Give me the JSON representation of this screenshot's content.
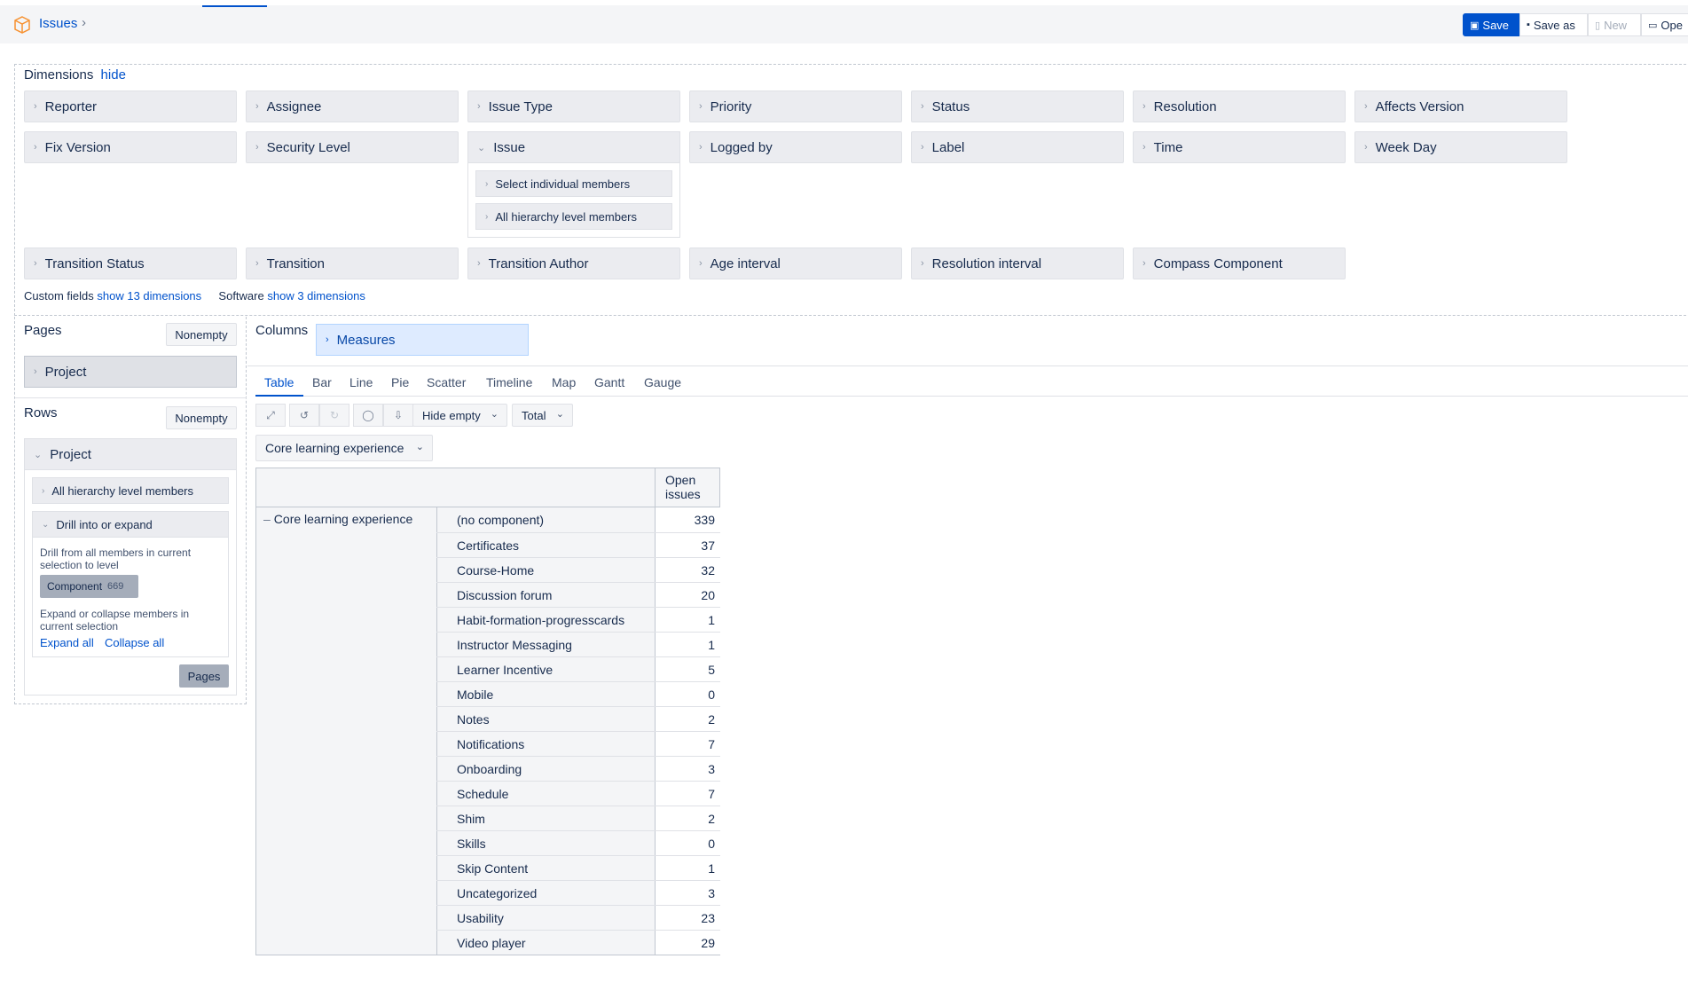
{
  "header": {
    "breadcrumb": "Issues",
    "buttons": {
      "save": "Save",
      "save_as": "Save as",
      "new": "New",
      "open": "Ope"
    }
  },
  "dimensions": {
    "title": "Dimensions",
    "hide_link": "hide",
    "row1": [
      "Reporter",
      "Assignee",
      "Issue Type",
      "Priority",
      "Status",
      "Resolution",
      "Affects Version"
    ],
    "row2": [
      "Fix Version",
      "Security Level",
      "Issue",
      "Logged by",
      "Label",
      "Time",
      "Week Day"
    ],
    "issue_sub": [
      "Select individual members",
      "All hierarchy level members"
    ],
    "row3": [
      "Transition Status",
      "Transition",
      "Transition Author",
      "Age interval",
      "Resolution interval",
      "Compass Component"
    ],
    "custom_fields_label": "Custom fields",
    "custom_fields_link": "show 13 dimensions",
    "software_label": "Software",
    "software_link": "show 3 dimensions"
  },
  "pages": {
    "label": "Pages",
    "nonempty": "Nonempty",
    "project": "Project"
  },
  "rows": {
    "label": "Rows",
    "nonempty": "Nonempty",
    "project": "Project",
    "all_hierarchy": "All hierarchy level members",
    "drill_title": "Drill into or expand",
    "drill_desc": "Drill from all members in current selection to level",
    "component_chip": "Component",
    "component_count": "669",
    "expand_desc": "Expand or collapse members in current selection",
    "expand_all": "Expand all",
    "collapse_all": "Collapse all",
    "pages_button": "Pages"
  },
  "columns": {
    "label": "Columns",
    "measures": "Measures"
  },
  "view_tabs": [
    "Table",
    "Bar",
    "Line",
    "Pie",
    "Scatter",
    "Timeline",
    "Map",
    "Gantt",
    "Gauge"
  ],
  "active_tab": "Table",
  "toolbar": {
    "hide_empty": "Hide empty",
    "total": "Total"
  },
  "page_filter": "Core learning experience",
  "table": {
    "column_header": "Open issues",
    "group_label": "Core learning experience",
    "rows": [
      {
        "name": "(no component)",
        "value": "339"
      },
      {
        "name": "Certificates",
        "value": "37"
      },
      {
        "name": "Course-Home",
        "value": "32"
      },
      {
        "name": "Discussion forum",
        "value": "20"
      },
      {
        "name": "Habit-formation-progresscards",
        "value": "1"
      },
      {
        "name": "Instructor Messaging",
        "value": "1"
      },
      {
        "name": "Learner Incentive",
        "value": "5"
      },
      {
        "name": "Mobile",
        "value": "0"
      },
      {
        "name": "Notes",
        "value": "2"
      },
      {
        "name": "Notifications",
        "value": "7"
      },
      {
        "name": "Onboarding",
        "value": "3"
      },
      {
        "name": "Schedule",
        "value": "7"
      },
      {
        "name": "Shim",
        "value": "2"
      },
      {
        "name": "Skills",
        "value": "0"
      },
      {
        "name": "Skip Content",
        "value": "1"
      },
      {
        "name": "Uncategorized",
        "value": "3"
      },
      {
        "name": "Usability",
        "value": "23"
      },
      {
        "name": "Video player",
        "value": "29"
      }
    ]
  }
}
